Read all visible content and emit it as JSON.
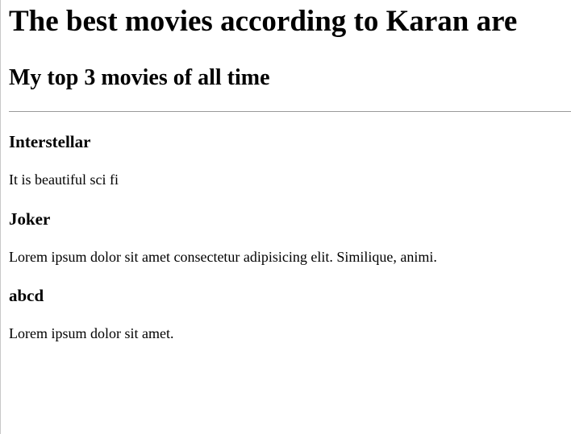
{
  "heading": "The best movies according to Karan are",
  "subheading": "My top 3 movies of all time",
  "movies": [
    {
      "title": "Interstellar",
      "description": "It is beautiful sci fi"
    },
    {
      "title": "Joker",
      "description": "Lorem ipsum dolor sit amet consectetur adipisicing elit. Similique, animi."
    },
    {
      "title": "abcd",
      "description": "Lorem ipsum dolor sit amet."
    }
  ]
}
